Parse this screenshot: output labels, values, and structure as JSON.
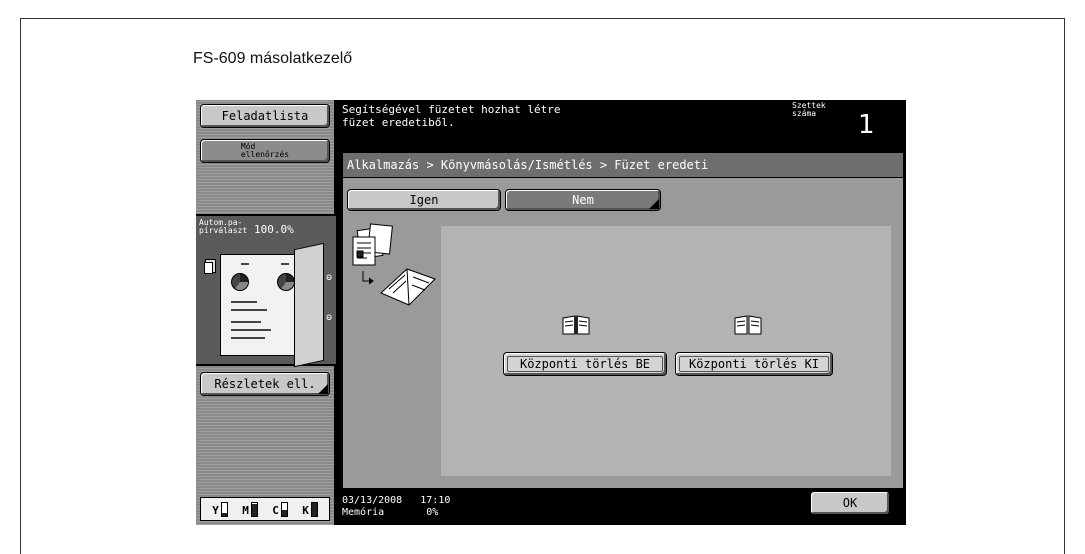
{
  "page_title": "FS-609 másolatkezelő",
  "left_panel": {
    "job_list_label": "Feladatlista",
    "mode_check_label": "Mód\nellenőrzés",
    "auto_paper_label": "Autom.pa-\npírválaszt",
    "zoom_value": "100.0%",
    "details_label": "Részletek ell.",
    "toner": [
      {
        "name": "Y",
        "level": 0.2
      },
      {
        "name": "M",
        "level": 0.9
      },
      {
        "name": "C",
        "level": 0.4
      },
      {
        "name": "K",
        "level": 1.0
      }
    ]
  },
  "message": "Segítségével füzetet hozhat létre\nfüzet eredetiből.",
  "sets": {
    "label": "Szettek\nszáma",
    "value": "1"
  },
  "breadcrumb": "Alkalmazás > Könyvmásolás/Ismétlés > Füzet eredeti",
  "options": {
    "yes_label": "Igen",
    "no_label": "Nem"
  },
  "center_erase": {
    "on_label": "Központi törlés BE",
    "off_label": "Központi törlés KI"
  },
  "status": {
    "datetime": "03/13/2008   17:10",
    "memory": "Memória       0%"
  },
  "ok_label": "OK",
  "icons": [
    "books-to-booklet-icon",
    "open-book-icon",
    "open-book-icon",
    "pie-chart-icon"
  ],
  "colors": {
    "screen_bg": "#000000",
    "panel_bg": "#9a9a9a",
    "button_bg": "#c8c8c8",
    "content_bg": "#b3b3b3"
  }
}
